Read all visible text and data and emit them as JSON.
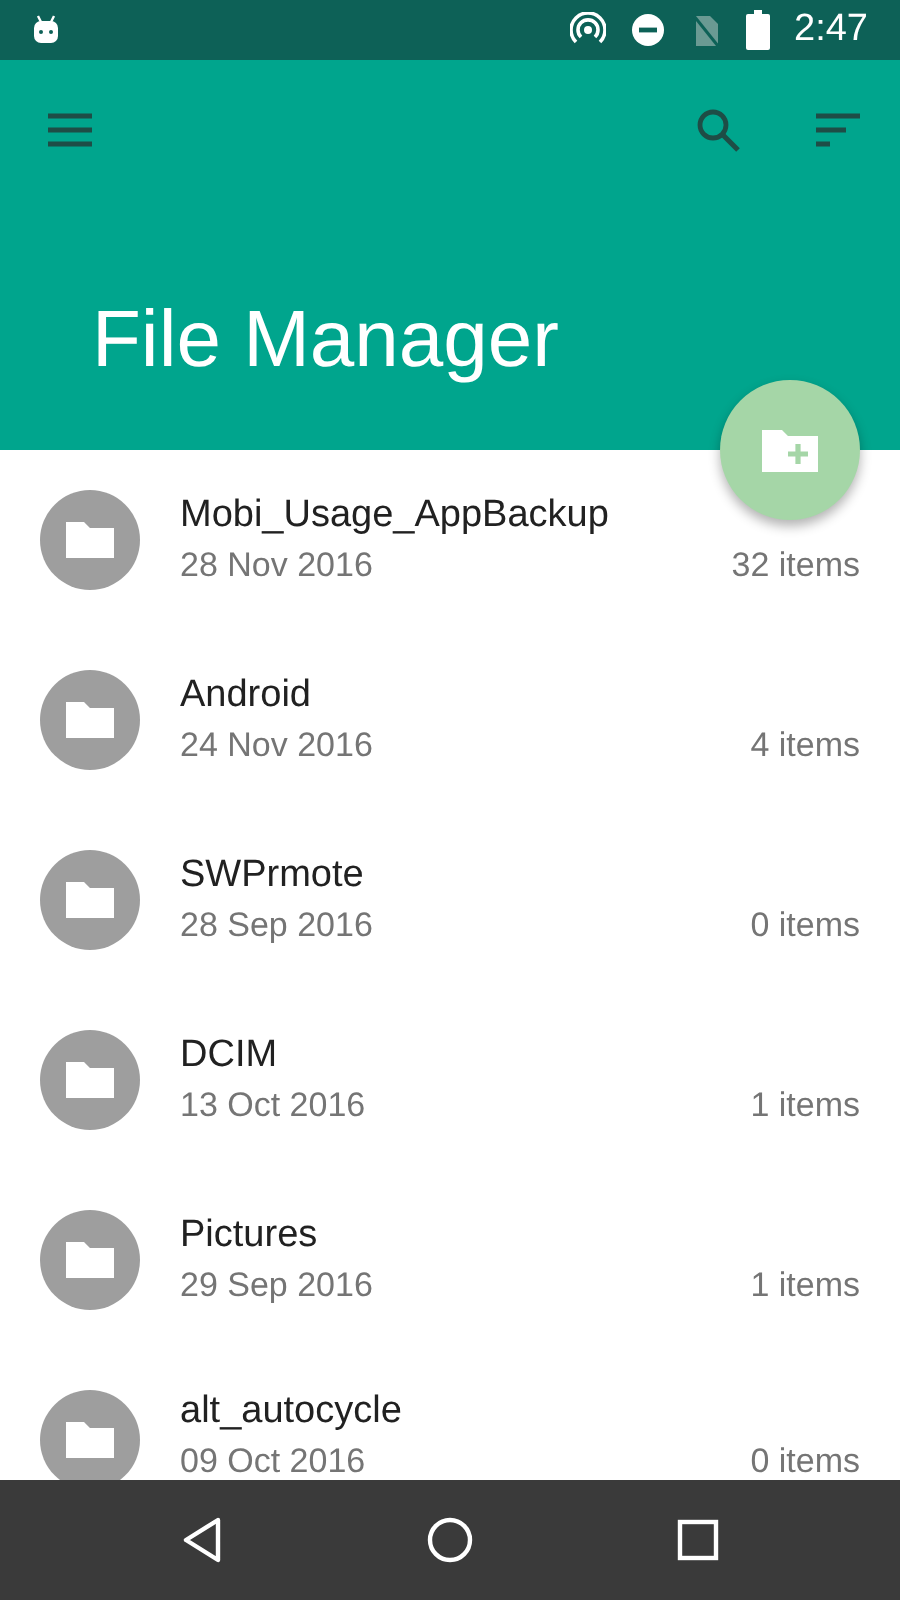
{
  "status_bar": {
    "time": "2:47"
  },
  "app_bar": {
    "title": "File Manager"
  },
  "folders": [
    {
      "name": "Mobi_Usage_AppBackup",
      "date": "28 Nov 2016",
      "count": "32 items"
    },
    {
      "name": "Android",
      "date": "24 Nov 2016",
      "count": "4 items"
    },
    {
      "name": "SWPrmote",
      "date": "28 Sep 2016",
      "count": "0 items"
    },
    {
      "name": "DCIM",
      "date": "13 Oct 2016",
      "count": "1 items"
    },
    {
      "name": "Pictures",
      "date": "29 Sep 2016",
      "count": "1 items"
    },
    {
      "name": "alt_autocycle",
      "date": "09 Oct 2016",
      "count": "0 items"
    }
  ]
}
